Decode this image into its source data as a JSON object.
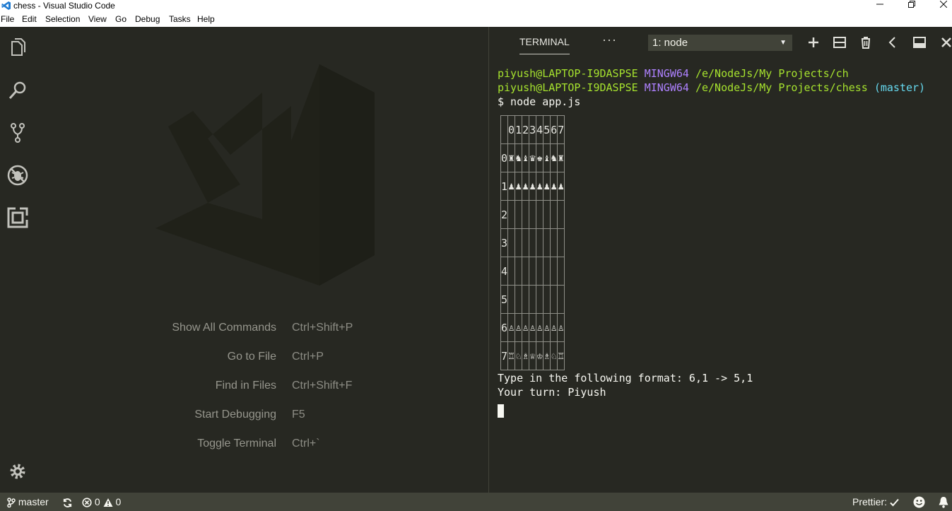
{
  "window": {
    "title": "chess - Visual Studio Code"
  },
  "menu": [
    "File",
    "Edit",
    "Selection",
    "View",
    "Go",
    "Debug",
    "Tasks",
    "Help"
  ],
  "activity_icons": [
    "files-icon",
    "search-icon",
    "source-control-icon",
    "debug-icon",
    "extensions-icon",
    "settings-gear-icon"
  ],
  "shortcuts": [
    {
      "label": "Show All Commands",
      "key": "Ctrl+Shift+P"
    },
    {
      "label": "Go to File",
      "key": "Ctrl+P"
    },
    {
      "label": "Find in Files",
      "key": "Ctrl+Shift+F"
    },
    {
      "label": "Start Debugging",
      "key": "F5"
    },
    {
      "label": "Toggle Terminal",
      "key": "Ctrl+`"
    }
  ],
  "panel": {
    "tab": "TERMINAL",
    "more": "···",
    "terminal_select": "1: node"
  },
  "terminal": {
    "line1_user": "piyush@LAPTOP-I9DASPSE",
    "line1_env": "MINGW64",
    "line1_path": "/e/NodeJs/My Projects/ch",
    "line2_user": "piyush@LAPTOP-I9DASPSE",
    "line2_env": "MINGW64",
    "line2_path": "/e/NodeJs/My Projects/chess",
    "line2_branch": "(master)",
    "command": "$ node app.js",
    "prompt_format": "Type in the following format: 6,1 -> 5,1",
    "turn": "Your turn: Piyush"
  },
  "board": {
    "col_headers": [
      "",
      "0",
      "1",
      "2",
      "3",
      "4",
      "5",
      "6",
      "7"
    ],
    "rows": [
      [
        "0",
        "♜",
        "♞",
        "♝",
        "♛",
        "♚",
        "♝",
        "♞",
        "♜"
      ],
      [
        "1",
        "♟",
        "♟",
        "♟",
        "♟",
        "♟",
        "♟",
        "♟",
        "♟"
      ],
      [
        "2",
        "",
        "",
        "",
        "",
        "",
        "",
        "",
        ""
      ],
      [
        "3",
        "",
        "",
        "",
        "",
        "",
        "",
        "",
        ""
      ],
      [
        "4",
        "",
        "",
        "",
        "",
        "",
        "",
        "",
        ""
      ],
      [
        "5",
        "",
        "",
        "",
        "",
        "",
        "",
        "",
        ""
      ],
      [
        "6",
        "♙",
        "♙",
        "♙",
        "♙",
        "♙",
        "♙",
        "♙",
        "♙"
      ],
      [
        "7",
        "♖",
        "♘",
        "♗",
        "♕",
        "♔",
        "♗",
        "♘",
        "♖"
      ]
    ]
  },
  "status": {
    "branch": "master",
    "errors": "0",
    "warnings": "0",
    "prettier": "Prettier:"
  }
}
